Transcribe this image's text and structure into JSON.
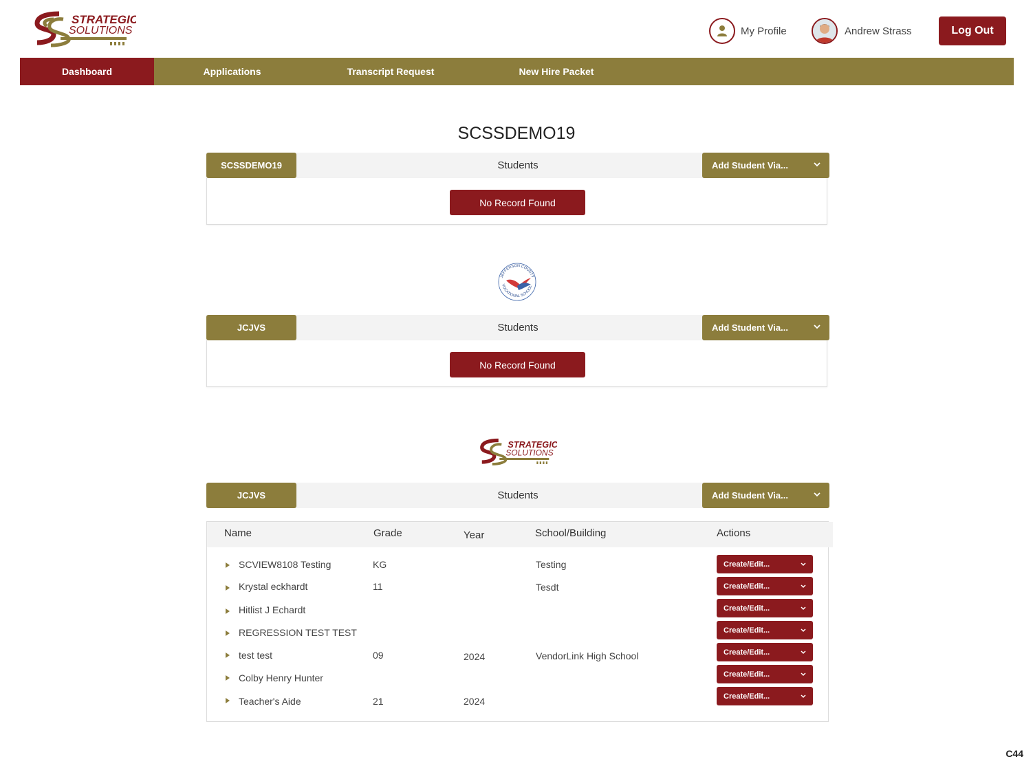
{
  "header": {
    "brand_line1": "STRATEGIC",
    "brand_line2": "SOLUTIONS",
    "my_profile": "My Profile",
    "user_name": "Andrew Strass",
    "logout": "Log Out"
  },
  "nav": {
    "items": [
      "Dashboard",
      "Applications",
      "Transcript Request",
      "New Hire Packet"
    ],
    "active": "Dashboard"
  },
  "page_title": "SCSSDEMO19",
  "panels": [
    {
      "school": "SCSSDEMO19",
      "label": "Students",
      "add": "Add Student Via...",
      "empty": "No Record Found"
    },
    {
      "school": "JCJVS",
      "label": "Students",
      "add": "Add Student Via...",
      "empty": "No Record Found"
    },
    {
      "school": "JCJVS",
      "label": "Students",
      "add": "Add Student Via..."
    }
  ],
  "emblem": {
    "top": "JEFFERSON COUNTY",
    "bottom": "VOCATIONAL SCHOOL"
  },
  "table": {
    "headers": [
      "Name",
      "Grade",
      "Year",
      "School/Building",
      "Actions"
    ],
    "action_label": "Create/Edit...",
    "rows": [
      {
        "name": "SCVIEW8108 Testing",
        "grade": "KG",
        "year": "",
        "school": "Testing"
      },
      {
        "name": "Krystal eckhardt",
        "grade": "11",
        "year": "",
        "school": "Tesdt"
      },
      {
        "name": "Hitlist J Echardt",
        "grade": "",
        "year": "",
        "school": ""
      },
      {
        "name": "REGRESSION TEST TEST",
        "grade": "",
        "year": "",
        "school": ""
      },
      {
        "name": "test test",
        "grade": "09",
        "year": "2024",
        "school": "VendorLink High School"
      },
      {
        "name": "Colby Henry Hunter",
        "grade": "",
        "year": "",
        "school": ""
      },
      {
        "name": "Teacher's Aide",
        "grade": "21",
        "year": "2024",
        "school": ""
      }
    ]
  },
  "footer_code": "C44",
  "colors": {
    "maroon": "#8b1a1e",
    "gold": "#8c7d3c"
  }
}
